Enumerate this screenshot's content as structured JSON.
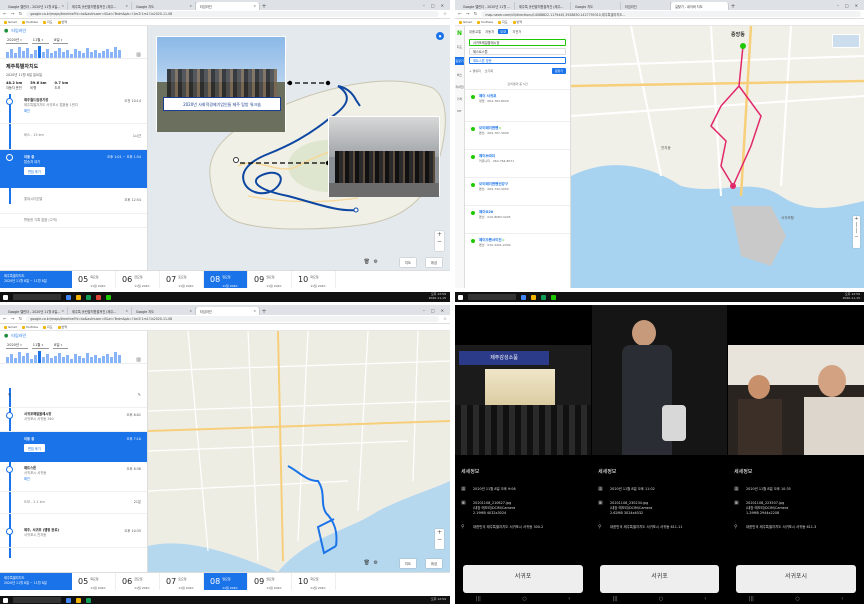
{
  "chrome_top_left": {
    "tabs": [
      "Google 캘린더 - 2020년 11월 8일...",
      "제주특 홀린출처원출쳐진 (제주...",
      "Google 지도",
      "타임라인"
    ],
    "url": "google.co.kr/maps/timeline?hl=ko&authuser=0&ei=Tedm&pb=!1m2!1m1!1s2020-11-08",
    "bookmarks": [
      "Gmail",
      "YouTube",
      "지도",
      "번역"
    ]
  },
  "chrome_top_right": {
    "tabs": [
      "Google 캘린더 - 2020년 11월 ...",
      "제주특 홀린출처원출쳐진 (제주...",
      "Google 지도",
      "타임라인",
      "길찾기 - 네이버 지도"
    ],
    "url": "map.naver.com/v5/directions/14088822.1179445,3928850.1427795310,제주특별자치도...",
    "bookmarks": [
      "Gmail",
      "YouTube",
      "지도",
      "번역"
    ]
  },
  "chrome_bottom_left": {
    "tabs": [
      "Google 캘린더 - 2020년 11월 8일...",
      "제주특 홀린출처원출쳐진 (제주...",
      "Google 지도",
      "타임라인"
    ],
    "url": "google.co.kr/maps/timeline?hl=ko&authuser=0&ei=Tedm&pb=!1m2!1m1!1s2020-11-08",
    "bookmarks": [
      "Gmail",
      "YouTube",
      "지도",
      "번역"
    ]
  },
  "timeline_top": {
    "title": "타임라인",
    "year": "2020년",
    "month": "11월",
    "day": "8일",
    "place_title": "제주특별자치도",
    "date_line": "2020년 11월 8일 일요일",
    "stats": [
      {
        "value": "48.2 km",
        "label": "자동차 운전"
      },
      {
        "value": "59.6 km",
        "label": "비행"
      },
      {
        "value": "0.7 km",
        "label": "도보"
      }
    ],
    "items": [
      {
        "title": "제주월드컵경기장",
        "sub": "제주특별자치도 서귀포시 법환동 1번지",
        "time": "오전 10:14",
        "action": "확인"
      },
      {
        "title": "버스 - 15 km",
        "sub": "",
        "time": "1시간"
      },
      {
        "title": "롯데시티호텔",
        "sub": "",
        "time": "오후 12:54"
      }
    ],
    "selected": {
      "title": "이동 중",
      "sub": "탑승자 대기",
      "time": "오후 1:01 ~ 오후 1:54",
      "button": "편집 후기"
    },
    "bottom_item": "활동한 기록 없음 (고객)"
  },
  "timeline_bottom": {
    "title": "타임라인",
    "year": "2020년",
    "month": "11월",
    "day": "8일",
    "items": [
      {
        "title": "서귀포매일올레시장",
        "sub": "서귀포시 서귀동 340",
        "time": "오후 6:01",
        "action": ""
      },
      {
        "title": "이동 중",
        "sub": "",
        "time": "오후 7:10",
        "action": "편집 후기"
      },
      {
        "title": "제트스톤",
        "sub": "서귀포시 서귀동",
        "time": "오후 8:38",
        "action": "확인"
      },
      {
        "title": "도보 - 2.1 km",
        "sub": "",
        "time": "21분",
        "action": ""
      },
      {
        "title": "제주, 서귀포 (맵핑 완료)",
        "sub": "서귀포시 천지동",
        "time": "오후 10:35",
        "action": ""
      }
    ]
  },
  "daystrip": {
    "selected_title": "제주특별자치도",
    "selected_sub": "2020년 11월 8일 ~ 11월 8일",
    "days": [
      {
        "num": "05",
        "dow": "목요일",
        "date": "11월 2020"
      },
      {
        "num": "06",
        "dow": "금요일",
        "date": "11월 2020"
      },
      {
        "num": "07",
        "dow": "토요일",
        "date": "11월 2020"
      },
      {
        "num": "08",
        "dow": "일요일",
        "date": "11월 2020"
      },
      {
        "num": "09",
        "dow": "월요일",
        "date": "11월 2020"
      },
      {
        "num": "10",
        "dow": "화요일",
        "date": "11월 2020"
      }
    ]
  },
  "map_buttons": {
    "map": "지도",
    "satellite": "위성"
  },
  "photo_banner": "2020년 사회적경제기업인들 제주 탐방 워크숍",
  "naver": {
    "logo": "N",
    "tabs": [
      "대중교통",
      "자동차",
      "도보",
      "자전거"
    ],
    "active_tab": "도보",
    "inputs": [
      "서귀포매일올레시장",
      "제스트스톤",
      "제트스톤 방문"
    ],
    "options": [
      "+ 경유지",
      "초기화"
    ],
    "go": "길찾기",
    "result_count": "검색결과 총 5건",
    "results": [
      {
        "name": "제이 서귀포",
        "sub": "영업 · 064-763-8029",
        "badge": ""
      },
      {
        "name": "모이래이엔펜",
        "sub": "펜션 · 064-767-3000",
        "badge": "0"
      },
      {
        "name": "제이브라더",
        "sub": "커뮤니티 · 064-764-8071",
        "badge": ""
      },
      {
        "name": "모이래이엔펜선강구",
        "sub": "펜션 · 064-732-3050",
        "badge": ""
      },
      {
        "name": "제이G20",
        "sub": "펜션 · 010-8083-3245",
        "badge": ""
      },
      {
        "name": "제이오펜서이진",
        "sub": "펜션 · 010-3201-2200",
        "badge": "0"
      }
    ],
    "rail": [
      "지도",
      "길찾기",
      "버스",
      "지하철",
      "기차",
      "MY"
    ],
    "map_labels": [
      "중앙동",
      "서귀포항",
      "천지동"
    ]
  },
  "taskbar": {
    "time": "오후 12:59",
    "date": "2020-11-15"
  },
  "phone": [
    {
      "heading": "세세정보",
      "datetime": "2020년 11월 8일 오후 9:06",
      "file": "20201108_210627.jpg",
      "path": "/내장 메모리/DCIM/Camera",
      "size": "2.19MB  4032x3024",
      "location": "대한민국 제주특별자치도 서귀포시 서귀동 300-2",
      "map_label": "서귀포"
    },
    {
      "heading": "세세정보",
      "datetime": "2020년 11월 8일 오후 11:02",
      "file": "20201108_230234.jpg",
      "path": "/내장 메모리/DCIM/Camera",
      "size": "2.62MB  3024x4032",
      "location": "대한민국 제주특별자치도 서귀포시 서귀동 611-11",
      "map_label": "서귀포"
    },
    {
      "heading": "세세정보",
      "datetime": "2020년 11월 8일 오후 10:35",
      "file": "20201108_223507.jpg",
      "path": "/내장 메모리/DCIM/Camera",
      "size": "1.29MB  2944x2208",
      "location": "대한민국 제주특별자치도 서귀포시 서귀동 611-3",
      "map_label": "서귀포시"
    }
  ],
  "photo_sign": "제주감성소품"
}
